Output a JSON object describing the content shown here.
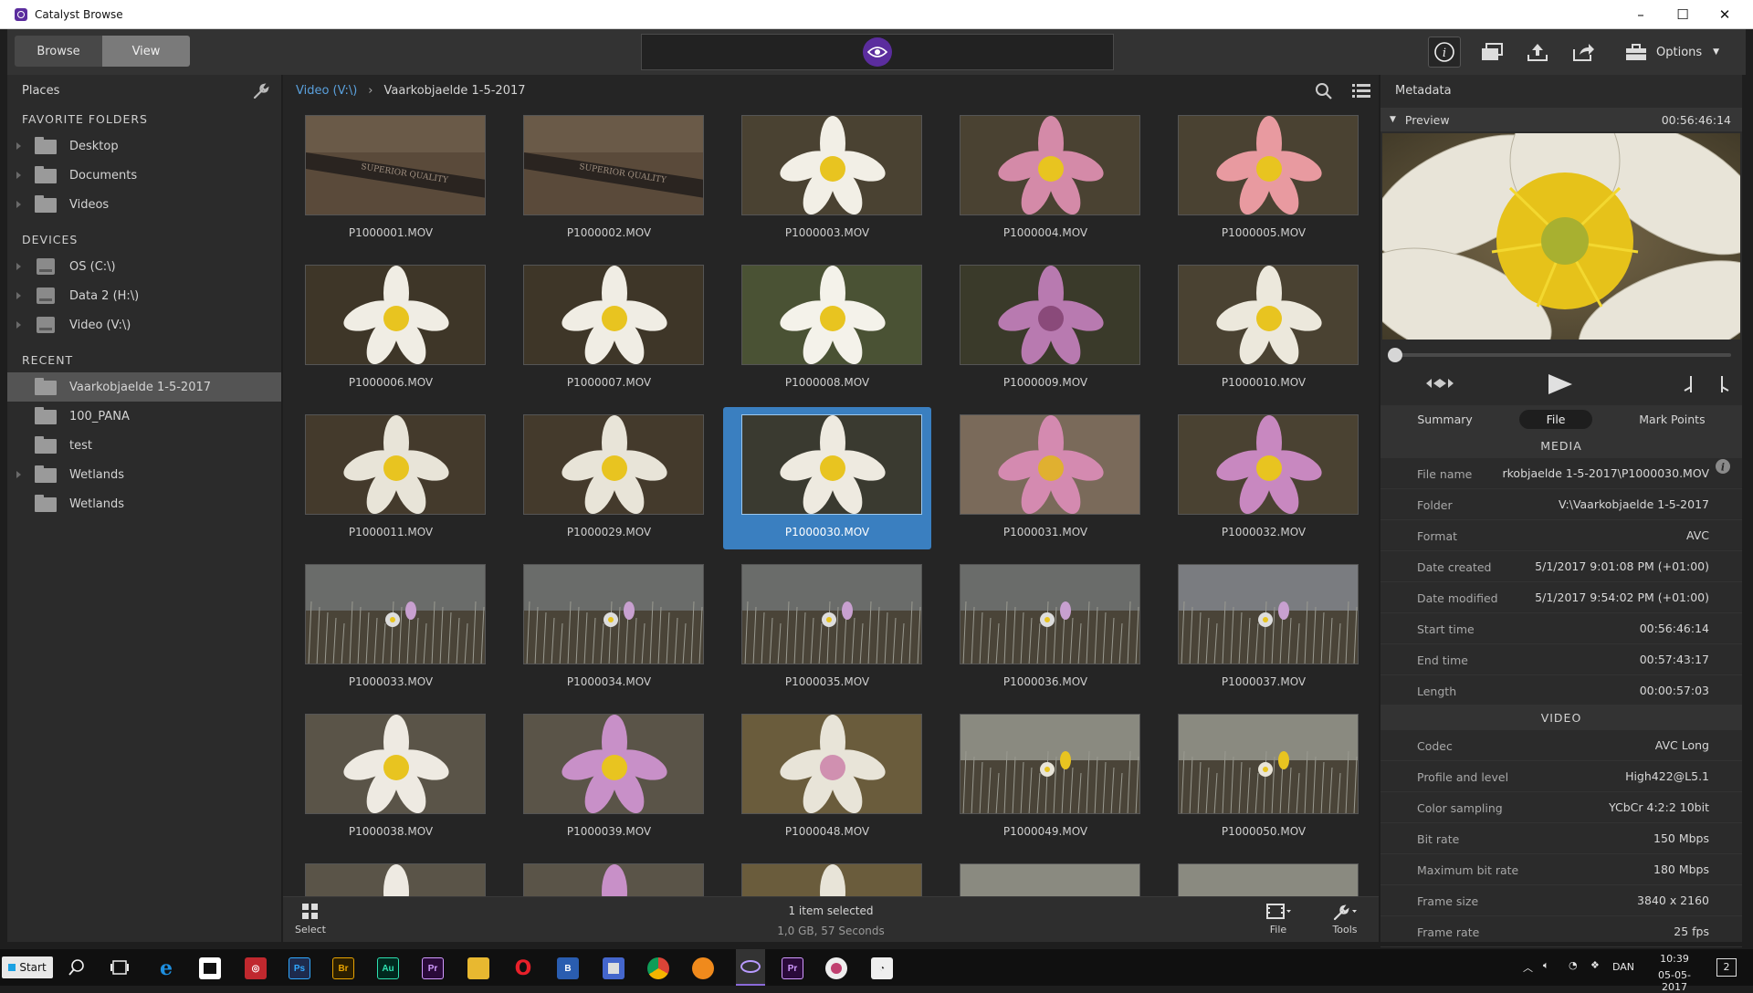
{
  "window": {
    "title": "Catalyst Browse",
    "controls": [
      "–",
      "☐",
      "✕"
    ]
  },
  "toolbar": {
    "browse_label": "Browse",
    "view_label": "View",
    "options_label": "Options"
  },
  "places": {
    "header": "Places",
    "favorites_header": "FAVORITE FOLDERS",
    "favorites": [
      "Desktop",
      "Documents",
      "Videos"
    ],
    "devices_header": "DEVICES",
    "devices": [
      "OS (C:\\)",
      "Data 2 (H:\\)",
      "Video (V:\\)"
    ],
    "recent_header": "RECENT",
    "recent": [
      "Vaarkobjaelde 1-5-2017",
      "100_PANA",
      "test",
      "Wetlands",
      "Wetlands"
    ]
  },
  "breadcrumb": {
    "root": "Video (V:\\)",
    "current": "Vaarkobjaelde 1-5-2017"
  },
  "files": [
    "P1000001.MOV",
    "P1000002.MOV",
    "P1000003.MOV",
    "P1000004.MOV",
    "P1000005.MOV",
    "P1000006.MOV",
    "P1000007.MOV",
    "P1000008.MOV",
    "P1000009.MOV",
    "P1000010.MOV",
    "P1000011.MOV",
    "P1000029.MOV",
    "P1000030.MOV",
    "P1000031.MOV",
    "P1000032.MOV",
    "P1000033.MOV",
    "P1000034.MOV",
    "P1000035.MOV",
    "P1000036.MOV",
    "P1000037.MOV",
    "P1000038.MOV",
    "P1000039.MOV",
    "P1000048.MOV",
    "P1000049.MOV",
    "P1000050.MOV"
  ],
  "selected_file": "P1000030.MOV",
  "status": {
    "select_label": "Select",
    "selection": "1 item selected",
    "details": "1,0 GB, 57 Seconds",
    "file_label": "File",
    "tools_label": "Tools"
  },
  "metadata": {
    "header": "Metadata",
    "preview_label": "Preview",
    "preview_timecode": "00:56:46:14",
    "tabs": [
      "Summary",
      "File",
      "Mark Points"
    ],
    "active_tab": "File",
    "media_header": "MEDIA",
    "media": [
      {
        "k": "File name",
        "v": "rkobjaelde 1-5-2017\\P1000030.MOV"
      },
      {
        "k": "Folder",
        "v": "V:\\Vaarkobjaelde 1-5-2017"
      },
      {
        "k": "Format",
        "v": "AVC"
      },
      {
        "k": "Date created",
        "v": "5/1/2017 9:01:08 PM (+01:00)"
      },
      {
        "k": "Date modified",
        "v": "5/1/2017 9:54:02 PM (+01:00)"
      },
      {
        "k": "Start time",
        "v": "00:56:46:14"
      },
      {
        "k": "End time",
        "v": "00:57:43:17"
      },
      {
        "k": "Length",
        "v": "00:00:57:03"
      }
    ],
    "video_header": "VIDEO",
    "video": [
      {
        "k": "Codec",
        "v": "AVC Long"
      },
      {
        "k": "Profile and level",
        "v": "High422@L5.1"
      },
      {
        "k": "Color sampling",
        "v": "YCbCr 4:2:2 10bit"
      },
      {
        "k": "Bit rate",
        "v": "150 Mbps"
      },
      {
        "k": "Maximum bit rate",
        "v": "180 Mbps"
      },
      {
        "k": "Frame size",
        "v": "3840 x 2160"
      },
      {
        "k": "Frame rate",
        "v": "25 fps"
      }
    ]
  },
  "taskbar": {
    "start_label": "Start",
    "apps": [
      "Ps",
      "Br",
      "Au",
      "Pr",
      "Pr"
    ],
    "lang": "DAN",
    "time": "10:39",
    "date": "05-05-2017",
    "notifications": "2"
  },
  "colors": {
    "accent_selected": "#3a7fc0",
    "brand_purple": "#5b2d9e",
    "link": "#5aa0dc"
  }
}
